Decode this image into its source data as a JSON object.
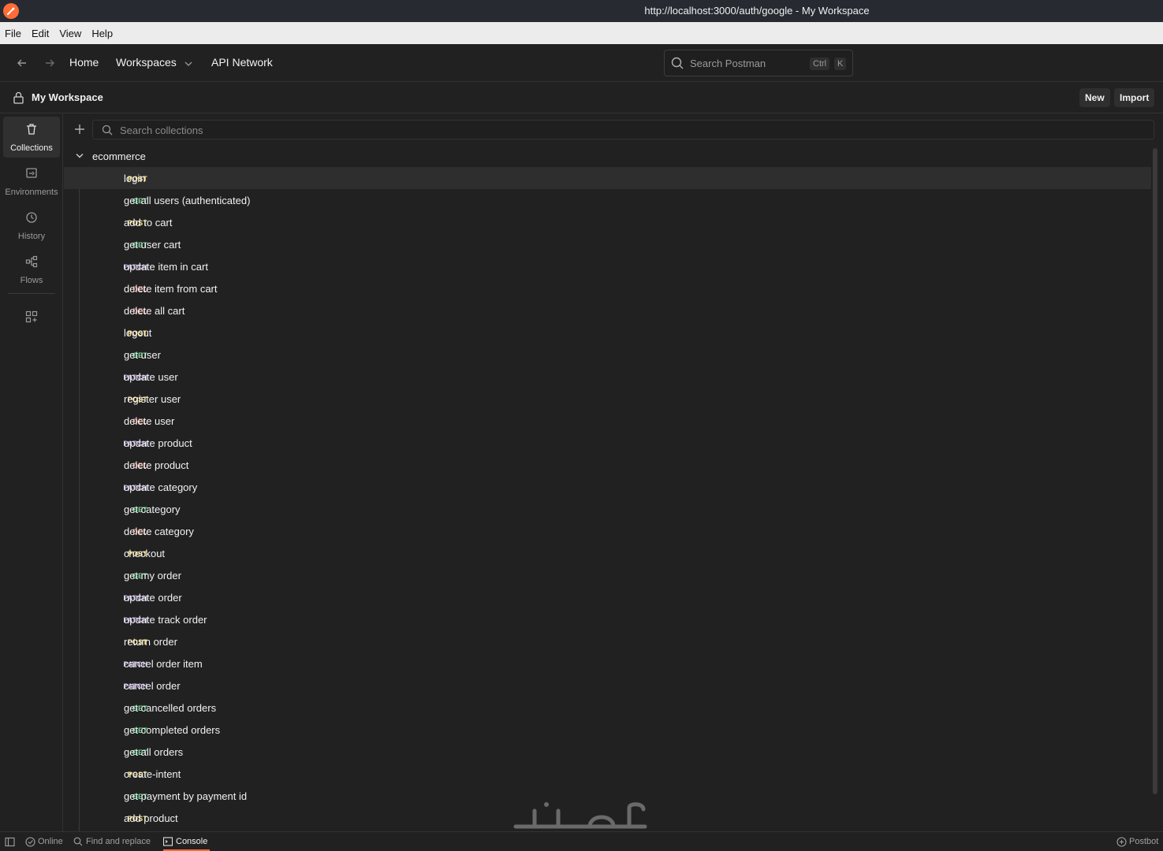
{
  "window": {
    "title": "http://localhost:3000/auth/google - My Workspace"
  },
  "menu": [
    "File",
    "Edit",
    "View",
    "Help"
  ],
  "header": {
    "home": "Home",
    "workspaces": "Workspaces",
    "api_network": "API Network",
    "search_placeholder": "Search Postman",
    "kbd_ctrl": "Ctrl",
    "kbd_k": "K"
  },
  "workspace": {
    "name": "My Workspace",
    "new_label": "New",
    "import_label": "Import"
  },
  "sidebar": {
    "items": [
      {
        "label": "Collections",
        "icon": "trash-can-icon"
      },
      {
        "label": "Environments",
        "icon": "environment-icon"
      },
      {
        "label": "History",
        "icon": "history-icon"
      },
      {
        "label": "Flows",
        "icon": "flows-icon"
      }
    ]
  },
  "collections": {
    "search_placeholder": "Search collections",
    "collection_name": "ecommerce",
    "requests": [
      {
        "method": "POST",
        "name": "login"
      },
      {
        "method": "GET",
        "name": "get all users (authenticated)"
      },
      {
        "method": "POST",
        "name": "add to cart"
      },
      {
        "method": "GET",
        "name": "get user cart"
      },
      {
        "method": "PATCH",
        "name": "update item in cart"
      },
      {
        "method": "DEL",
        "name": "delete item from cart"
      },
      {
        "method": "DEL",
        "name": "delete all cart"
      },
      {
        "method": "POST",
        "name": "logout"
      },
      {
        "method": "GET",
        "name": "get user"
      },
      {
        "method": "PATCH",
        "name": "update user"
      },
      {
        "method": "POST",
        "name": "register user"
      },
      {
        "method": "DEL",
        "name": "delete user"
      },
      {
        "method": "PATCH",
        "name": "update product"
      },
      {
        "method": "DEL",
        "name": "delete product"
      },
      {
        "method": "PATCH",
        "name": "update category"
      },
      {
        "method": "GET",
        "name": "get category"
      },
      {
        "method": "DEL",
        "name": "delete category"
      },
      {
        "method": "POST",
        "name": "checkout"
      },
      {
        "method": "GET",
        "name": "get my order"
      },
      {
        "method": "PATCH",
        "name": "update order"
      },
      {
        "method": "PATCH",
        "name": "update track order"
      },
      {
        "method": "POST",
        "name": "return order"
      },
      {
        "method": "PATCH",
        "name": "cancel order item"
      },
      {
        "method": "PATCH",
        "name": "cancel order"
      },
      {
        "method": "GET",
        "name": "get cancelled orders"
      },
      {
        "method": "GET",
        "name": "get completed orders"
      },
      {
        "method": "GET",
        "name": "get all orders"
      },
      {
        "method": "POST",
        "name": "create-intent"
      },
      {
        "method": "GET",
        "name": "get payment by payment id"
      },
      {
        "method": "POST",
        "name": "add product"
      }
    ]
  },
  "statusbar": {
    "online": "Online",
    "find_replace": "Find and replace",
    "console": "Console",
    "postbot": "Postbot"
  },
  "colors": {
    "accent": "#ff6c37",
    "post": "#ffe47e",
    "get": "#6bdd9a",
    "patch": "#c0a8e1",
    "del": "#f79a8e"
  }
}
